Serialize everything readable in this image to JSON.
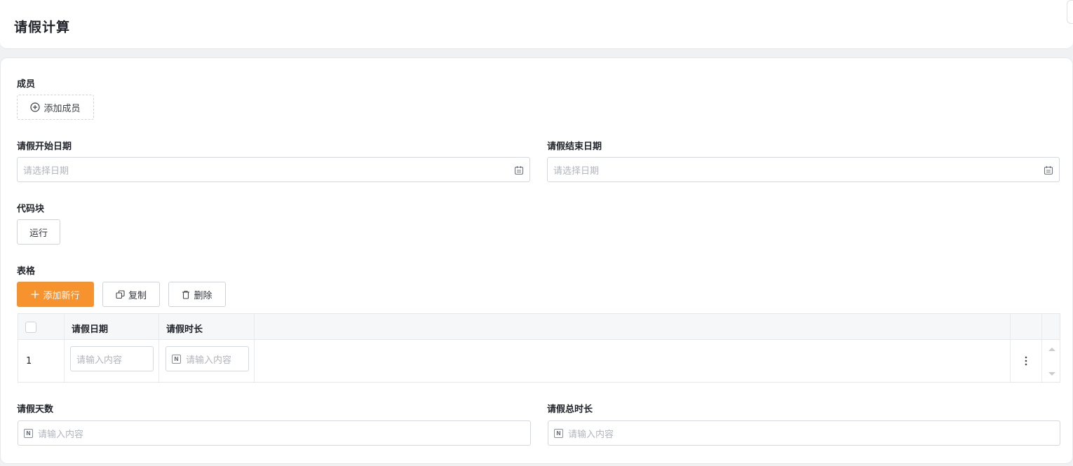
{
  "header": {
    "title": "请假计算"
  },
  "members": {
    "label": "成员",
    "add_button": "添加成员"
  },
  "start_date": {
    "label": "请假开始日期",
    "placeholder": "请选择日期"
  },
  "end_date": {
    "label": "请假结束日期",
    "placeholder": "请选择日期"
  },
  "code_block": {
    "label": "代码块",
    "run_button": "运行"
  },
  "table": {
    "label": "表格",
    "add_row_button": "添加新行",
    "copy_button": "复制",
    "delete_button": "删除",
    "columns": [
      "请假日期",
      "请假时长"
    ],
    "rows": [
      {
        "index": "1",
        "date_placeholder": "请输入内容",
        "duration_placeholder": "请输入内容"
      }
    ]
  },
  "leave_days": {
    "label": "请假天数",
    "placeholder": "请输入内容"
  },
  "leave_total": {
    "label": "请假总时长",
    "placeholder": "请输入内容"
  },
  "colors": {
    "accent": "#f7932e",
    "border": "#d5d8dd",
    "placeholder": "#b1b5bc"
  },
  "icons": {
    "add_member": "plus-circle-icon",
    "calendar": "calendar-icon",
    "add_row": "plus-icon",
    "copy": "copy-icon",
    "delete": "trash-icon",
    "number": "number-n-icon",
    "more": "more-vertical-icon"
  }
}
